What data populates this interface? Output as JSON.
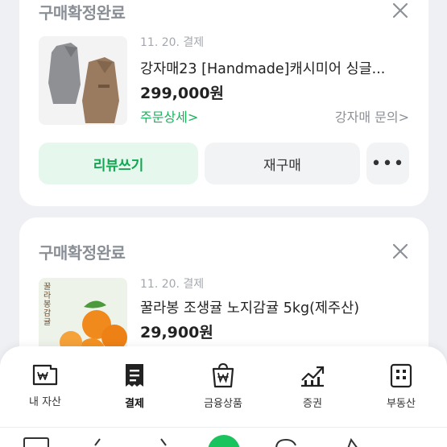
{
  "orders": [
    {
      "status": "구매확정완료",
      "date": "11. 20. 결제",
      "title": "강자매23 [Handmade]캐시미어 싱글...",
      "price": "299,000원",
      "detail_link": "주문상세>",
      "seller_link": "강자매 문의>",
      "review_button": "리뷰쓰기",
      "rebuy_button": "재구매",
      "more_button": "•••"
    },
    {
      "status": "구매확정완료",
      "date": "11. 20. 결제",
      "title": "꿀라봉 조생귤 노지감귤 5kg(제주산)",
      "price": "29,900원",
      "thumb_text": "꿀라봉감귤"
    }
  ],
  "bottom_nav": [
    {
      "label": "내 자산",
      "icon": "wallet-won-icon"
    },
    {
      "label": "결제",
      "icon": "receipt-icon",
      "active": true
    },
    {
      "label": "금융상품",
      "icon": "bag-won-icon"
    },
    {
      "label": "증권",
      "icon": "stock-chart-icon"
    },
    {
      "label": "부동산",
      "icon": "building-icon"
    }
  ],
  "colors": {
    "accent_green": "#19b35d",
    "review_bg": "#e6f7ee",
    "background": "#eef0f3"
  }
}
